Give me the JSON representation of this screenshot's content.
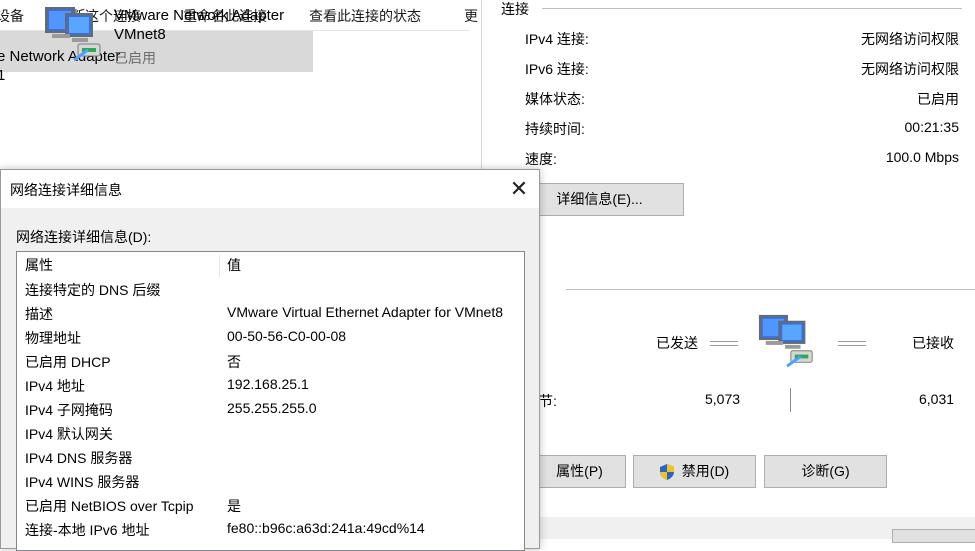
{
  "explorer": {
    "toolbar": [
      {
        "label": "设备"
      },
      {
        "label": "诊断这个连接"
      },
      {
        "label": "重命名此连接"
      },
      {
        "label": "查看此连接的状态"
      },
      {
        "label": "更"
      }
    ],
    "adapter1": {
      "line1": "e Network Adapter",
      "line2": "1"
    },
    "adapter2": {
      "name": "VMware Network Adapter",
      "name2": "VMnet8",
      "status": "已启用"
    }
  },
  "status": {
    "group": "连接",
    "rows": [
      {
        "label": "IPv4 连接:",
        "value": "无网络访问权限"
      },
      {
        "label": "IPv6 连接:",
        "value": "无网络访问权限"
      },
      {
        "label": "媒体状态:",
        "value": "已启用"
      },
      {
        "label": "持续时间:",
        "value": "00:21:35"
      },
      {
        "label": "速度:",
        "value": "100.0 Mbps"
      }
    ],
    "details_button": "详细信息(E)...",
    "activity": {
      "sent_label": "已发送",
      "received_label": "已接收",
      "bytes_label": "节:",
      "sent": "5,073",
      "received": "6,031"
    },
    "buttons": {
      "properties": "属性(P)",
      "disable": "禁用(D)",
      "diagnose": "诊断(G)"
    }
  },
  "dialog": {
    "title": "网络连接详细信息",
    "list_label": "网络连接详细信息(D):",
    "header": {
      "property": "属性",
      "value": "值"
    },
    "rows": [
      {
        "p": "连接特定的 DNS 后缀",
        "v": ""
      },
      {
        "p": "描述",
        "v": "VMware Virtual Ethernet Adapter for VMnet8"
      },
      {
        "p": "物理地址",
        "v": "00-50-56-C0-00-08"
      },
      {
        "p": "已启用 DHCP",
        "v": "否"
      },
      {
        "p": "IPv4 地址",
        "v": "192.168.25.1"
      },
      {
        "p": "IPv4 子网掩码",
        "v": "255.255.255.0"
      },
      {
        "p": "IPv4 默认网关",
        "v": ""
      },
      {
        "p": "IPv4 DNS 服务器",
        "v": ""
      },
      {
        "p": "IPv4 WINS 服务器",
        "v": ""
      },
      {
        "p": "已启用 NetBIOS over Tcpip",
        "v": "是"
      },
      {
        "p": "连接-本地 IPv6 地址",
        "v": "fe80::b96c:a63d:241a:49cd%14"
      }
    ]
  },
  "colors": {
    "selected_bg": "#d9d9d9",
    "button_bg": "#e1e1e1",
    "dialog_bg": "#f0f0f0"
  },
  "icons": {
    "network": "network-computers-icon",
    "shield": "uac-shield-icon",
    "close": "close-icon"
  }
}
